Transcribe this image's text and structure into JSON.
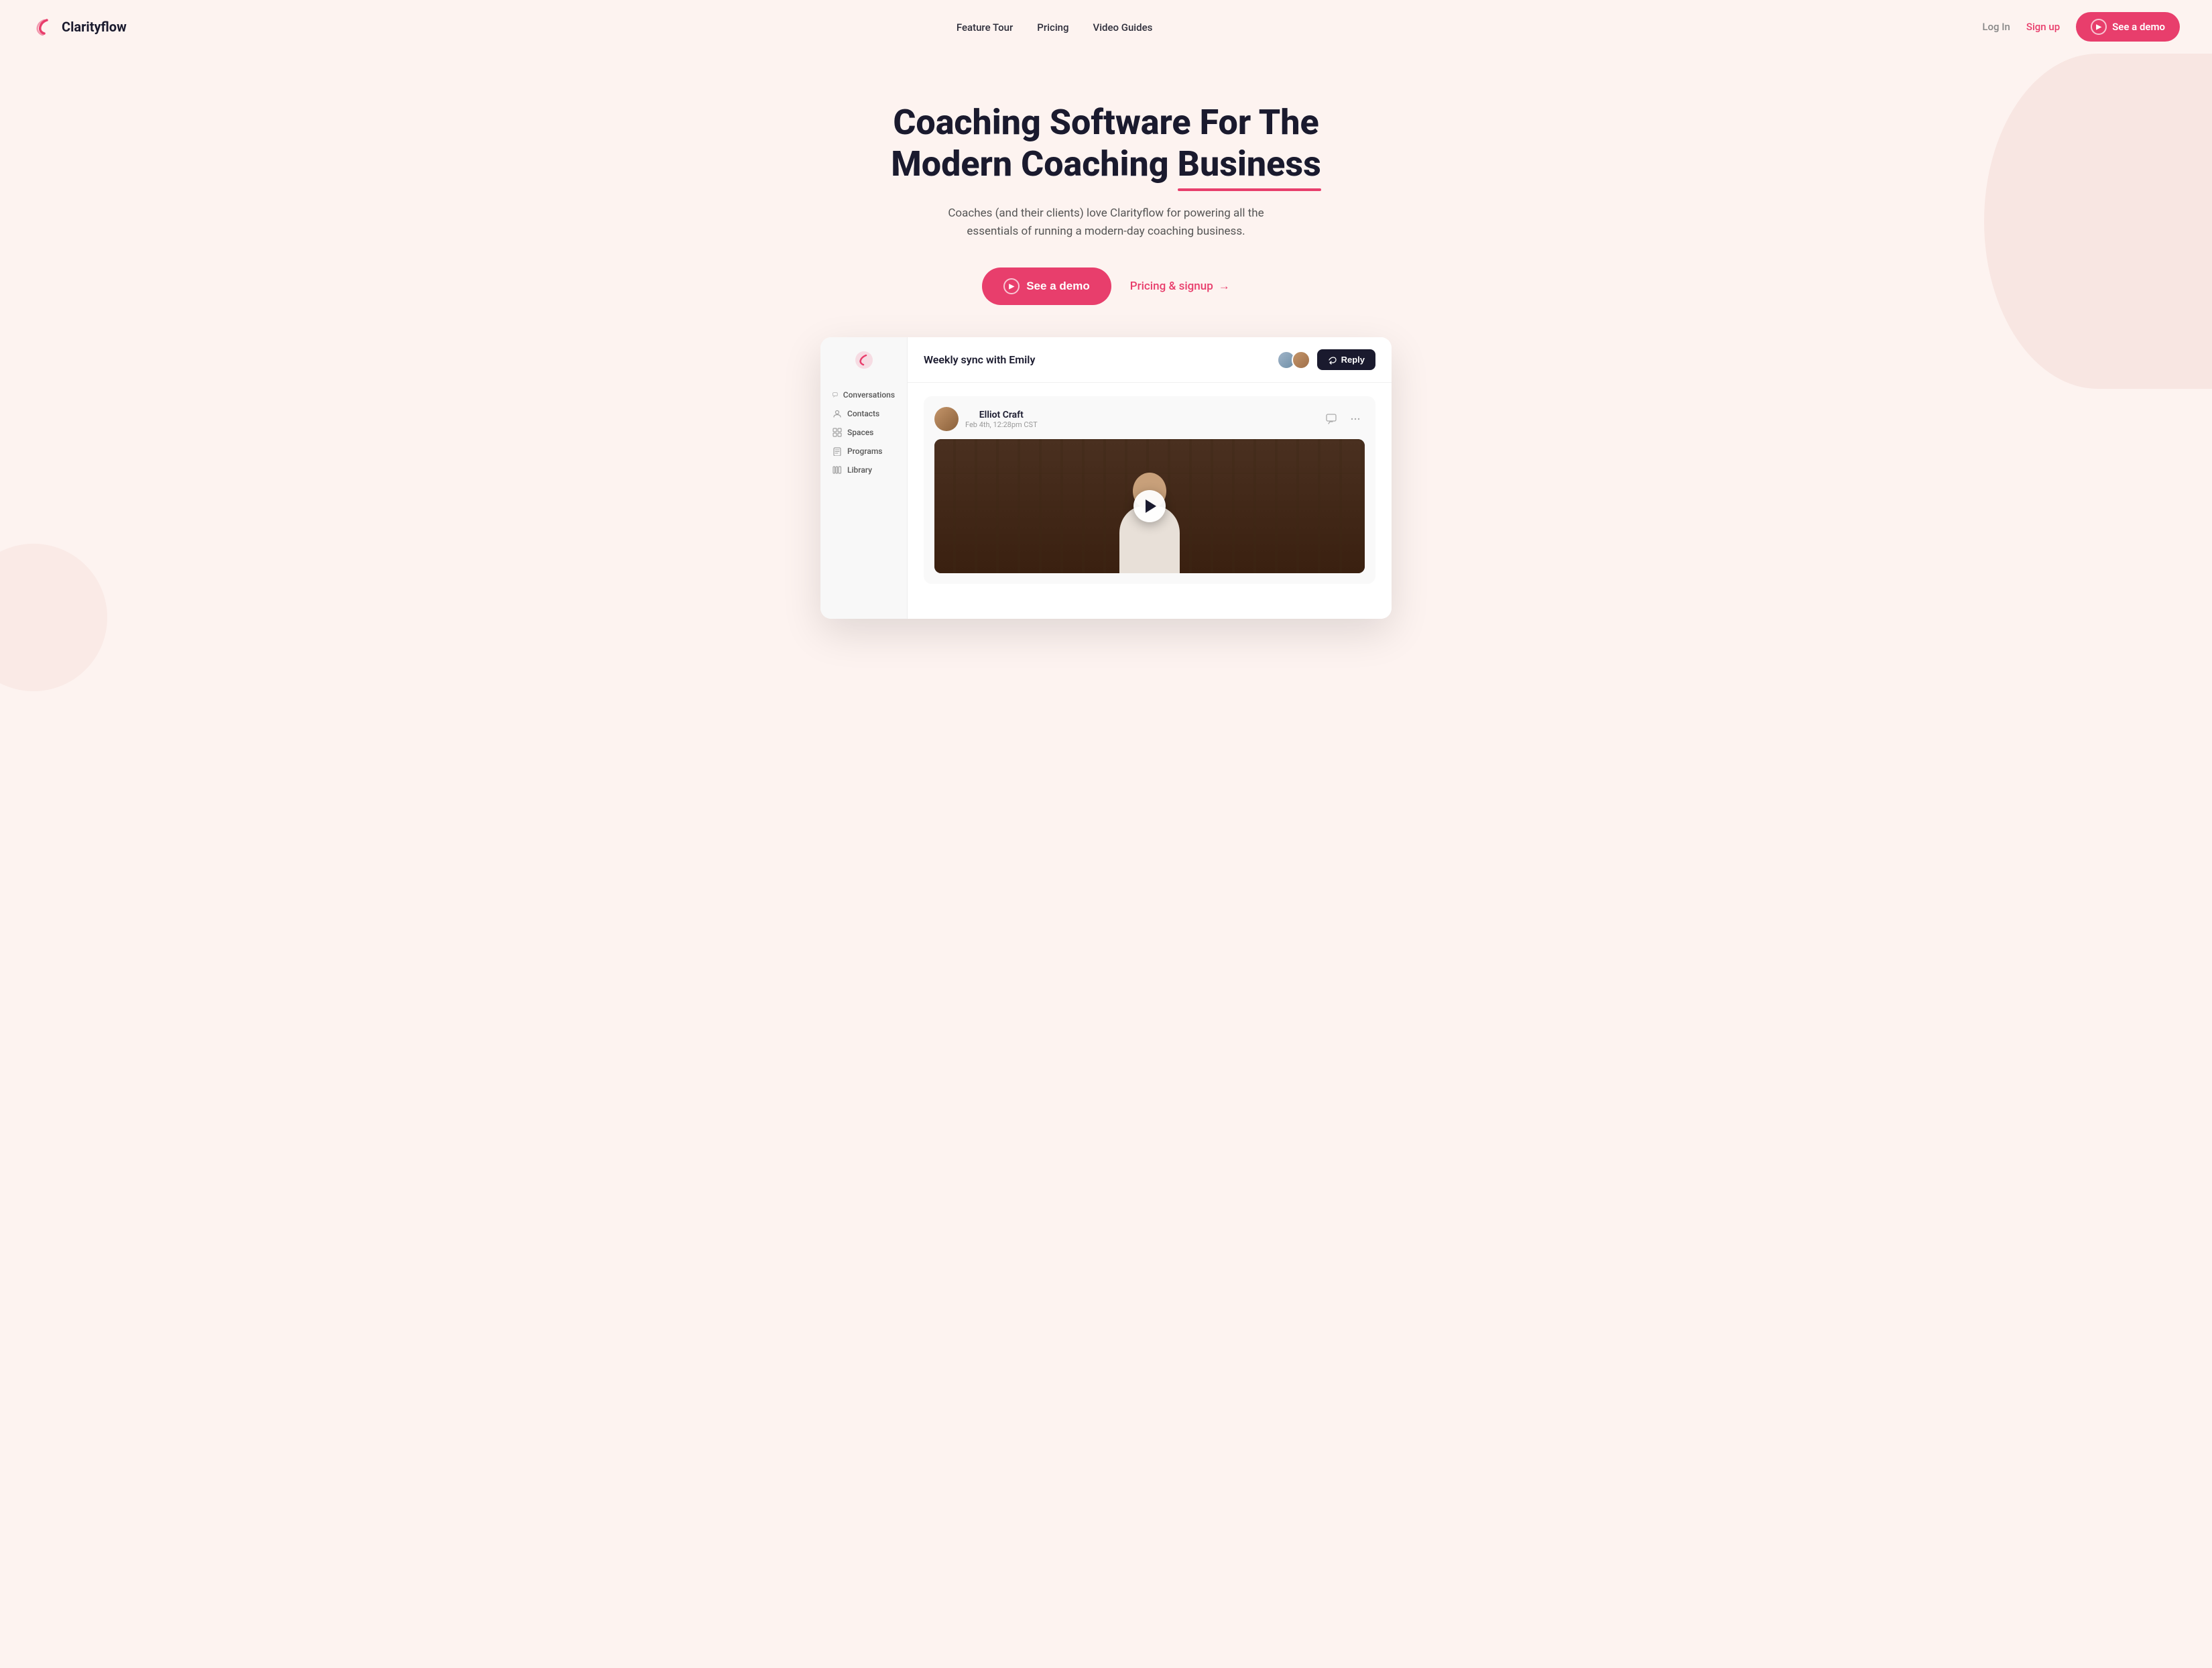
{
  "nav": {
    "logo_text": "Clarityflow",
    "links": [
      {
        "label": "Feature Tour",
        "id": "feature-tour"
      },
      {
        "label": "Pricing",
        "id": "pricing"
      },
      {
        "label": "Video Guides",
        "id": "video-guides"
      }
    ],
    "login_label": "Log In",
    "signup_label": "Sign up",
    "demo_btn_label": "See a demo"
  },
  "hero": {
    "headline_line1": "Coaching Software For The",
    "headline_line2": "Modern Coaching",
    "headline_underline_word": "Business",
    "subtitle": "Coaches (and their clients) love Clarityflow for powering all the essentials of running a modern-day coaching business.",
    "cta_demo_label": "See a demo",
    "cta_pricing_label": "Pricing & signup",
    "cta_pricing_arrow": "→"
  },
  "mockup": {
    "window_title": "Weekly sync with Emily",
    "reply_btn_label": "Reply",
    "sidebar": {
      "nav_items": [
        {
          "label": "Conversations",
          "icon": "chat-icon"
        },
        {
          "label": "Contacts",
          "icon": "contacts-icon"
        },
        {
          "label": "Spaces",
          "icon": "spaces-icon"
        },
        {
          "label": "Programs",
          "icon": "programs-icon"
        },
        {
          "label": "Library",
          "icon": "library-icon"
        }
      ]
    },
    "message": {
      "author_name": "Elliot Craft",
      "author_date": "Feb 4th, 12:28pm CST",
      "has_video": true
    }
  }
}
